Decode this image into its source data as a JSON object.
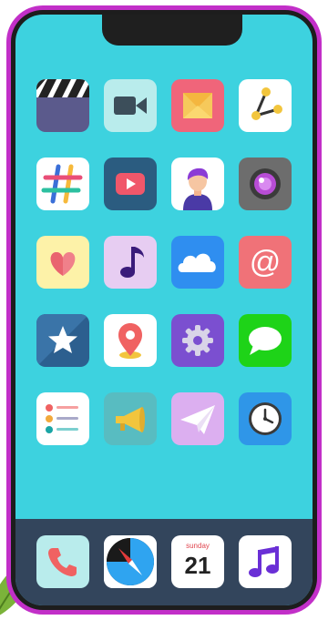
{
  "home_screen": {
    "rows": [
      [
        "clapperboard-app",
        "video-camera-app",
        "mail-app",
        "share-app"
      ],
      [
        "hashtag-app",
        "youtube-app",
        "contacts-app",
        "camera-lens-app"
      ],
      [
        "health-heart-app",
        "music-note-app",
        "cloud-app",
        "email-at-app"
      ],
      [
        "favorites-star-app",
        "maps-pin-app",
        "settings-app",
        "messages-app"
      ],
      [
        "reminders-list-app",
        "megaphone-app",
        "send-plane-app",
        "clock-app"
      ]
    ]
  },
  "dock": {
    "apps": [
      "phone-app",
      "compass-app",
      "calendar-app",
      "music-app"
    ],
    "calendar": {
      "weekday": "sunday",
      "day": "21"
    }
  },
  "colors": {
    "frame": "#c22fc8",
    "screen": "#3dd2df",
    "dock": "#33455c"
  }
}
